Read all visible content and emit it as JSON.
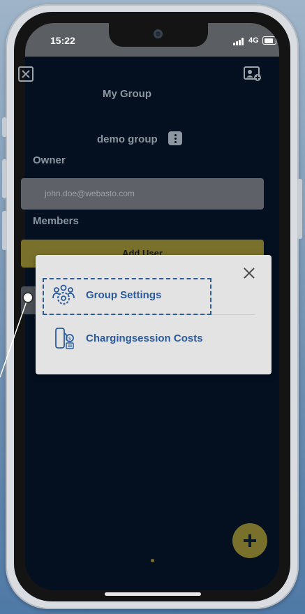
{
  "status_bar": {
    "time": "15:22",
    "network": "4G",
    "battery_level": 0.8
  },
  "header": {
    "title": "My Group"
  },
  "group": {
    "name": "demo group"
  },
  "owner": {
    "label": "Owner",
    "email": "john.doe@webasto.com"
  },
  "members": {
    "label": "Members",
    "add_user_label": "Add User"
  },
  "menu": {
    "items": [
      {
        "label": "Group Settings",
        "icon": "group-gear-icon",
        "highlighted": true
      },
      {
        "label": "Chargingsession Costs",
        "icon": "charger-cost-icon",
        "highlighted": false
      }
    ]
  },
  "colors": {
    "background": "#04101f",
    "accent": "#79712b",
    "menu_text": "#2b5a9e",
    "highlight_border": "#2b5a9e"
  }
}
